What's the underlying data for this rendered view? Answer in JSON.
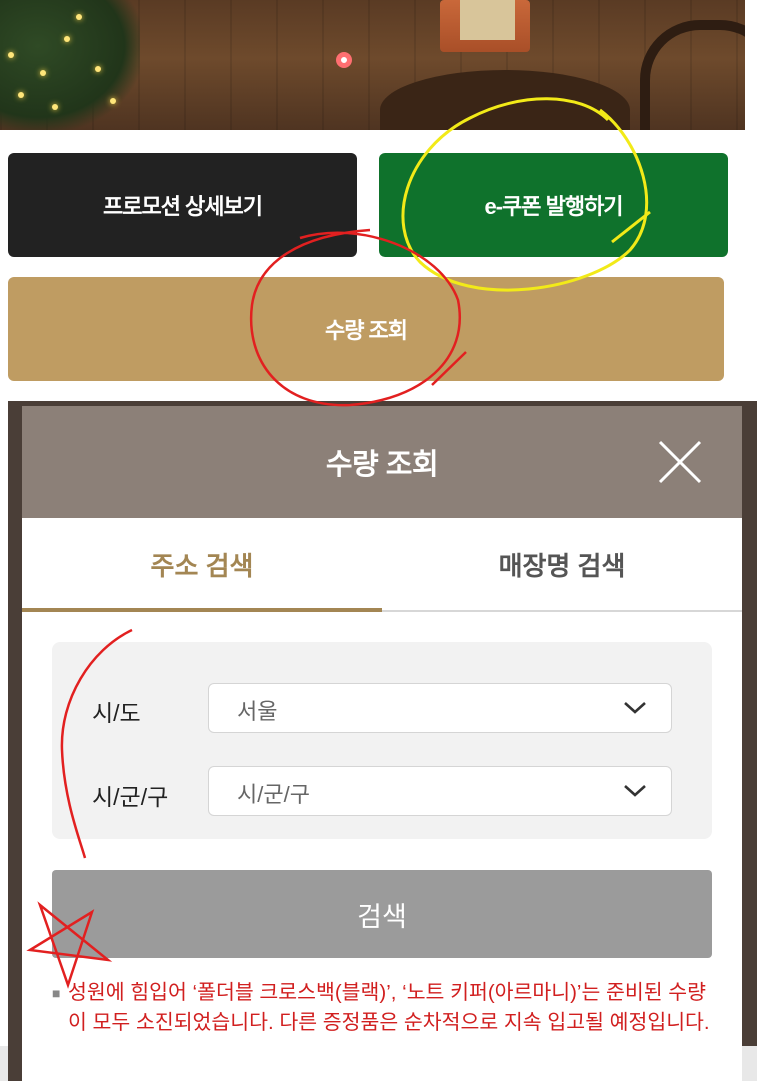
{
  "banner": {
    "indicator_icon": "carousel-dot",
    "accent_color": "#ff6f71"
  },
  "buttons": {
    "promo_label": "프로모션 상세보기",
    "coupon_label": "e-쿠폰 발행하기",
    "stock_label": "수량 조회",
    "colors": {
      "promo": "#222222",
      "coupon": "#0f722c",
      "stock": "#bf9c62"
    }
  },
  "modal": {
    "title": "수량 조회",
    "close_icon": "close-icon",
    "tabs": [
      {
        "label": "주소 검색",
        "active": true
      },
      {
        "label": "매장명 검색",
        "active": false
      }
    ],
    "fields": {
      "province_label": "시/도",
      "province_value": "서울",
      "district_label": "시/군/구",
      "district_value": "시/군/구"
    },
    "search_label": "검색",
    "notice_text": "성원에 힘입어 ‘폴더블 크로스백(블랙)’, ‘노트 키퍼(아르마니)’는 준비된 수량이 모두 소진되었습니다. 다른 증정품은 순차적으로 지속 입고될 예정입니다.",
    "header_color": "#8c8078",
    "tab_active_color": "#a38653"
  }
}
